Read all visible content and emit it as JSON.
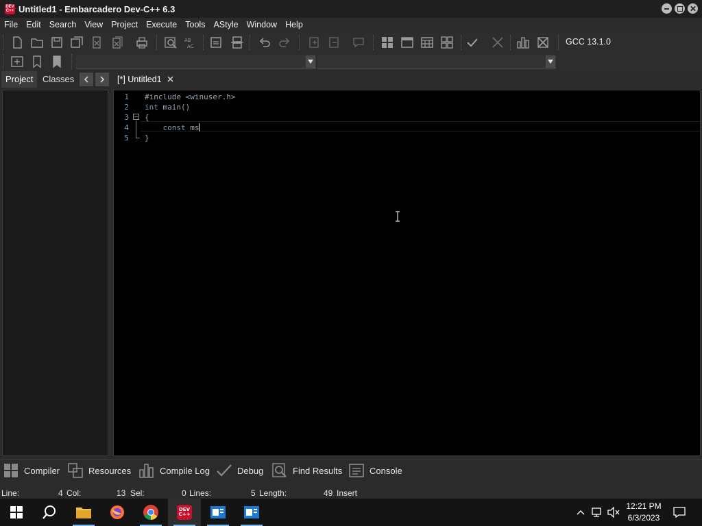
{
  "window": {
    "title": "Untitled1 - Embarcadero Dev-C++ 6.3",
    "icon_text": "DEV C++"
  },
  "menu": [
    "File",
    "Edit",
    "Search",
    "View",
    "Project",
    "Execute",
    "Tools",
    "AStyle",
    "Window",
    "Help"
  ],
  "toolbar": {
    "compiler_label": "GCC 13.1.0",
    "icons": [
      "new-file-icon",
      "open-icon",
      "save-icon",
      "save-all-icon",
      "close-file-icon",
      "close-all-icon",
      "print-icon",
      "find-icon",
      "replace-icon",
      "goto-line-icon",
      "toggle-panel-icon",
      "undo-icon",
      "redo-icon",
      "indent-icon",
      "unindent-icon",
      "comment-icon",
      "project-grid-icon",
      "window-icon",
      "calendar-icon",
      "options-icon",
      "check-icon",
      "cross-icon",
      "chart-icon",
      "clean-icon"
    ]
  },
  "left_panel": {
    "tabs": [
      "Project",
      "Classes"
    ],
    "active_tab": "Project"
  },
  "editor": {
    "tab_label": "[*] Untitled1",
    "lines": [
      {
        "n": "1",
        "text": "#include <winuser.h>"
      },
      {
        "n": "2",
        "kw": "int",
        "text": " main()"
      },
      {
        "n": "3",
        "text": "{"
      },
      {
        "n": "4",
        "kw": "    const",
        "text": " ms"
      },
      {
        "n": "5",
        "text": "}"
      }
    ]
  },
  "output_tabs": [
    "Compiler",
    "Resources",
    "Compile Log",
    "Debug",
    "Find Results",
    "Console"
  ],
  "status": {
    "line_label": "Line:",
    "line_value": "4",
    "col_label": "Col:",
    "col_value": "13",
    "sel_label": "Sel:",
    "sel_value": "0",
    "lines_label": "Lines:",
    "lines_value": "5",
    "length_label": "Length:",
    "length_value": "49",
    "mode": "Insert"
  },
  "taskbar": {
    "time": "12:21 PM",
    "date": "6/3/2023",
    "devcpp_icon_text": "DEV C++"
  },
  "colors": {
    "accent": "#76b9ed",
    "app_icon": "#c8102e"
  }
}
